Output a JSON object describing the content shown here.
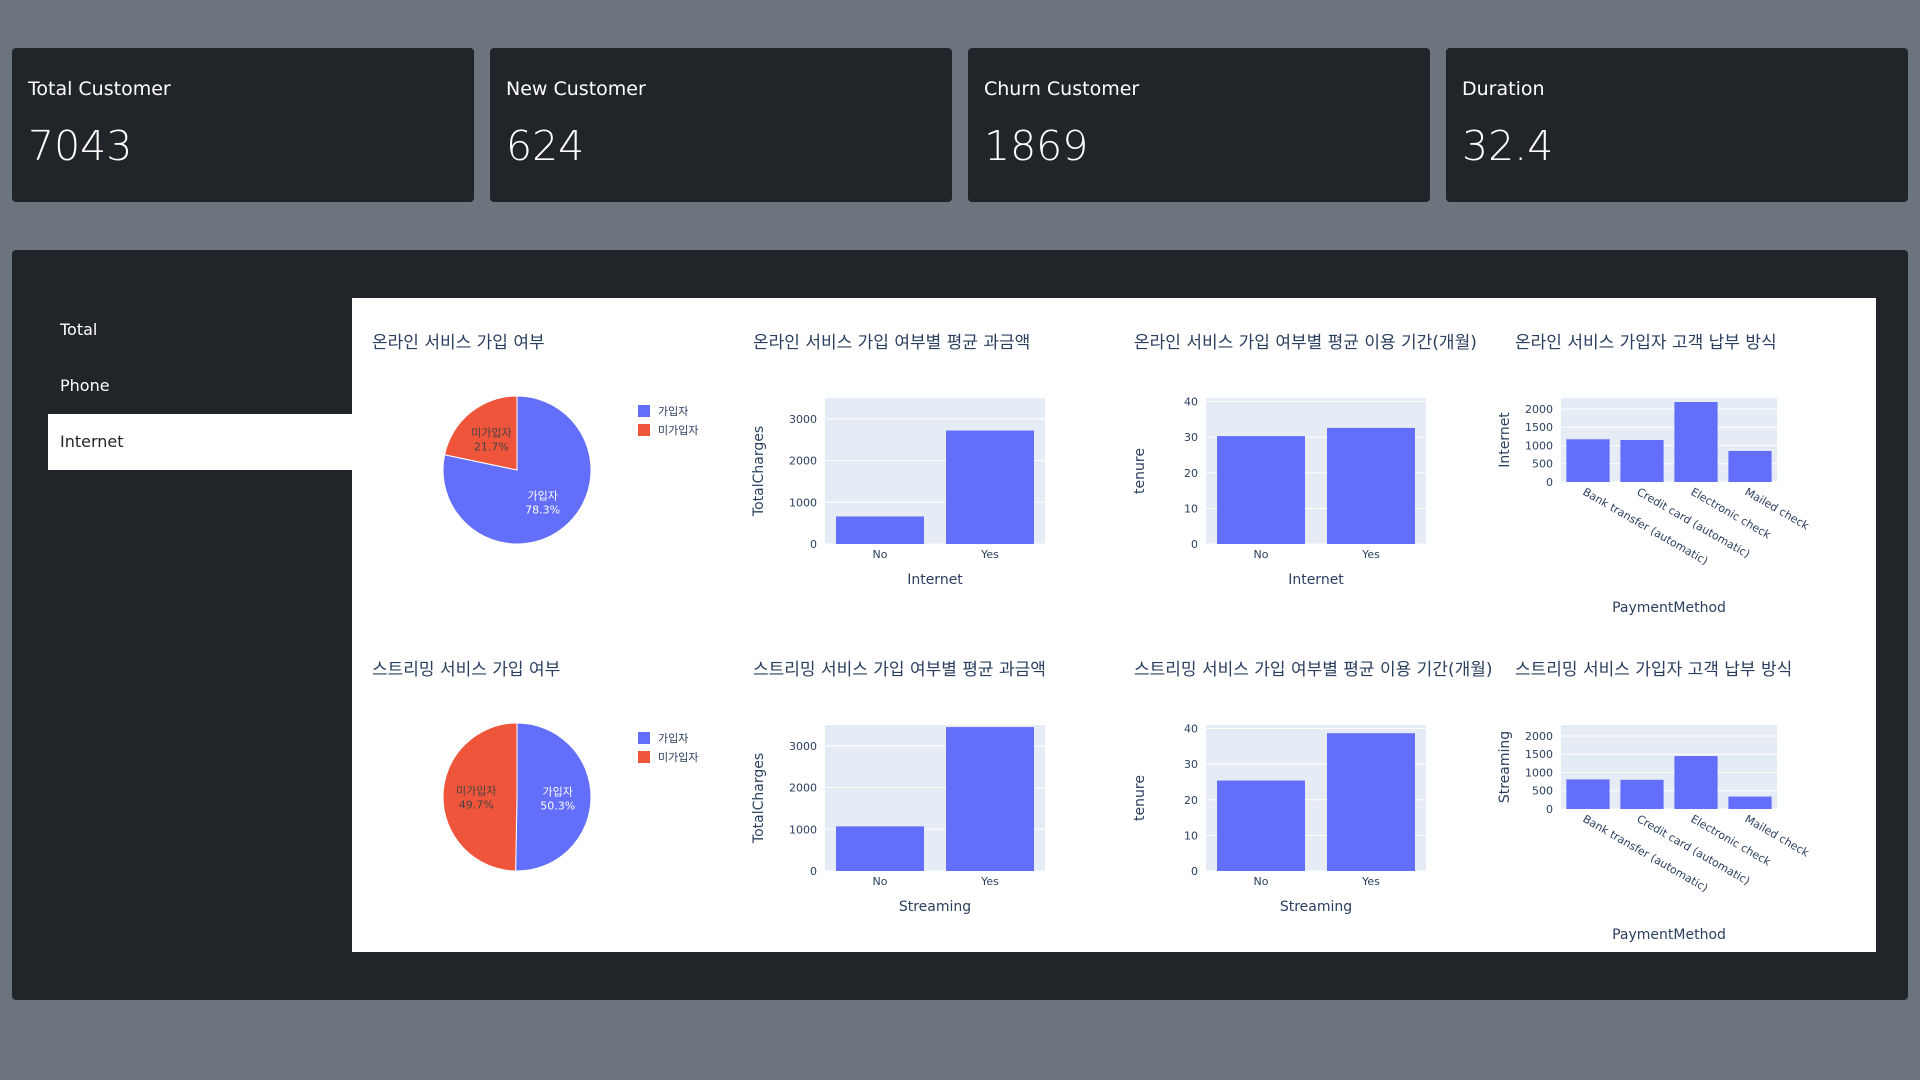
{
  "kpis": [
    {
      "label": "Total Customer",
      "value": "7043"
    },
    {
      "label": "New Customer",
      "value": "624"
    },
    {
      "label": "Churn Customer",
      "value": "1869"
    },
    {
      "label": "Duration",
      "value": "32.4"
    }
  ],
  "nav": {
    "items": [
      {
        "label": "Total"
      },
      {
        "label": "Phone"
      },
      {
        "label": "Internet"
      }
    ],
    "active": "Internet"
  },
  "colors": {
    "primary": "#636efa",
    "secondary": "#ef553b",
    "plot_bg": "#e5ecf6",
    "text": "#2a3f5f"
  },
  "chart_data": [
    {
      "type": "pie",
      "title": "온라인 서비스 가입 여부",
      "labels": [
        "가입자",
        "미가입자"
      ],
      "values": [
        78.3,
        21.7
      ],
      "text": [
        "78.3%",
        "21.7%"
      ],
      "legend": "right"
    },
    {
      "type": "bar",
      "title": "온라인 서비스 가입 여부별 평균 과금액",
      "categories": [
        "No",
        "Yes"
      ],
      "values": [
        660,
        2720
      ],
      "xlabel": "Internet",
      "ylabel": "TotalCharges",
      "ylim": [
        0,
        3500
      ],
      "yticks": [
        0,
        1000,
        2000,
        3000
      ]
    },
    {
      "type": "bar",
      "title": "온라인 서비스 가입 여부별 평균 이용 기간(개월)",
      "categories": [
        "No",
        "Yes"
      ],
      "values": [
        30.3,
        32.6
      ],
      "xlabel": "Internet",
      "ylabel": "tenure",
      "ylim": [
        0,
        41
      ],
      "yticks": [
        0,
        10,
        20,
        30,
        40
      ]
    },
    {
      "type": "bar",
      "title": "온라인 서비스 가입자 고객 납부 방식",
      "categories": [
        "Bank transfer (automatic)",
        "Credit card (automatic)",
        "Electronic check",
        "Mailed check"
      ],
      "values": [
        1170,
        1150,
        2190,
        850
      ],
      "xlabel": "PaymentMethod",
      "ylabel": "Internet",
      "ylim": [
        0,
        2300
      ],
      "yticks": [
        0,
        500,
        1000,
        1500,
        2000
      ]
    },
    {
      "type": "pie",
      "title": "스트리밍 서비스 가입 여부",
      "labels": [
        "가입자",
        "미가입자"
      ],
      "values": [
        50.3,
        49.7
      ],
      "text": [
        "50.3%",
        "49.7%"
      ],
      "legend": "right"
    },
    {
      "type": "bar",
      "title": "스트리밍 서비스 가입 여부별 평균 과금액",
      "categories": [
        "No",
        "Yes"
      ],
      "values": [
        1070,
        3450
      ],
      "xlabel": "Streaming",
      "ylabel": "TotalCharges",
      "ylim": [
        0,
        3500
      ],
      "yticks": [
        0,
        1000,
        2000,
        3000
      ]
    },
    {
      "type": "bar",
      "title": "스트리밍 서비스 가입 여부별 평균 이용 기간(개월)",
      "categories": [
        "No",
        "Yes"
      ],
      "values": [
        25.4,
        38.7
      ],
      "xlabel": "Streaming",
      "ylabel": "tenure",
      "ylim": [
        0,
        41
      ],
      "yticks": [
        0,
        10,
        20,
        30,
        40
      ]
    },
    {
      "type": "bar",
      "title": "스트리밍 서비스 가입자 고객 납부 방식",
      "categories": [
        "Bank transfer (automatic)",
        "Credit card (automatic)",
        "Electronic check",
        "Mailed check"
      ],
      "values": [
        810,
        800,
        1450,
        340
      ],
      "xlabel": "PaymentMethod",
      "ylabel": "Streaming",
      "ylim": [
        0,
        2300
      ],
      "yticks": [
        0,
        500,
        1000,
        1500,
        2000
      ]
    }
  ]
}
